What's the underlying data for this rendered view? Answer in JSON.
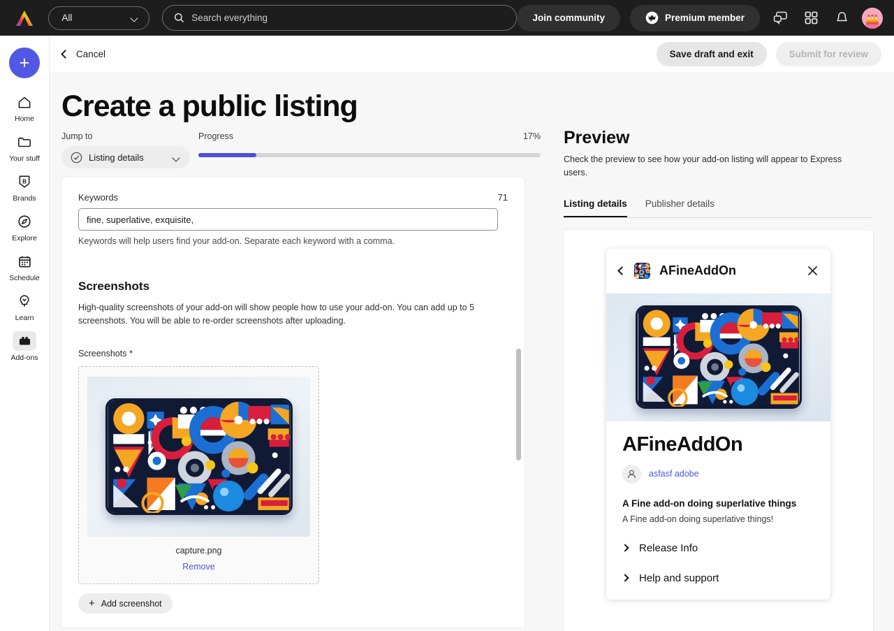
{
  "topbar": {
    "logo_name": "adobe-express-logo",
    "filter": {
      "label": "All",
      "icon": "chevron-down-icon"
    },
    "search": {
      "placeholder": "Search everything",
      "value": "",
      "icon": "search-icon"
    },
    "join_community_label": "Join community",
    "premium_label": "Premium member",
    "premium_icon": "crown-check-icon",
    "chat_icon": "chat-bubbles-icon",
    "apps_icon": "grid-apps-icon",
    "bell_icon": "notification-bell-icon",
    "avatar_icon": "user-avatar-cake"
  },
  "sidebar": {
    "create_label": "+",
    "items": [
      {
        "label": "Home",
        "icon": "home-icon",
        "active": false
      },
      {
        "label": "Your stuff",
        "icon": "folder-icon",
        "active": false
      },
      {
        "label": "Brands",
        "icon": "brand-badge-icon",
        "active": false
      },
      {
        "label": "Explore",
        "icon": "compass-icon",
        "active": false
      },
      {
        "label": "Schedule",
        "icon": "calendar-icon",
        "active": false
      },
      {
        "label": "Learn",
        "icon": "lightbulb-idea-icon",
        "active": false
      },
      {
        "label": "Add-ons",
        "icon": "addons-icon",
        "active": true
      }
    ]
  },
  "subheader": {
    "cancel_label": "Cancel",
    "back_icon": "chevron-left-icon",
    "save_draft_label": "Save draft and exit",
    "submit_label": "Submit for review"
  },
  "page": {
    "title": "Create a public listing"
  },
  "progress": {
    "jump_to_label": "Jump to",
    "jump_to_value": "Listing details",
    "jump_to_check_icon": "check-circle-icon",
    "jump_to_chevron_icon": "chevron-down-icon",
    "progress_label": "Progress",
    "percent_text": "17%",
    "percent_value": 17,
    "accent_color": "#4b50d6"
  },
  "form": {
    "keywords": {
      "label": "Keywords",
      "counter": "71",
      "value": "fine, superlative, exquisite,",
      "placeholder": "",
      "help": "Keywords will help users find your add-on. Separate each keyword with a comma."
    },
    "screenshots": {
      "section_title": "Screenshots",
      "section_desc": "High-quality screenshots of your add-on will show people how to use your add-on. You can add up to 5 screenshots. You will be able to re-order screenshots after uploading.",
      "field_label": "Screenshots *",
      "items": [
        {
          "file_name": "capture.png",
          "remove_label": "Remove",
          "thumbnail": "abstract-geometric-art"
        }
      ],
      "add_label": "Add screenshot",
      "add_icon": "plus-icon"
    }
  },
  "preview": {
    "title": "Preview",
    "description": "Check the preview to see how your add-on listing will appear to Express users.",
    "tabs": [
      {
        "label": "Listing details",
        "active": true
      },
      {
        "label": "Publisher details",
        "active": false
      }
    ],
    "card": {
      "back_icon": "chevron-left-icon",
      "app_icon": "addon-thumbnail-icon",
      "header_name": "AFineAddOn",
      "close_icon": "close-icon",
      "hero_image": "abstract-geometric-art",
      "addon_title": "AFineAddOn",
      "publisher_avatar_icon": "person-icon",
      "publisher_name": "asfasf adobe",
      "tagline": "A Fine add-on doing superlative things",
      "description": "A Fine add-on doing superlative things!",
      "accordions": [
        {
          "label": "Release Info",
          "icon": "chevron-right-icon"
        },
        {
          "label": "Help and support",
          "icon": "chevron-right-icon"
        }
      ]
    }
  }
}
